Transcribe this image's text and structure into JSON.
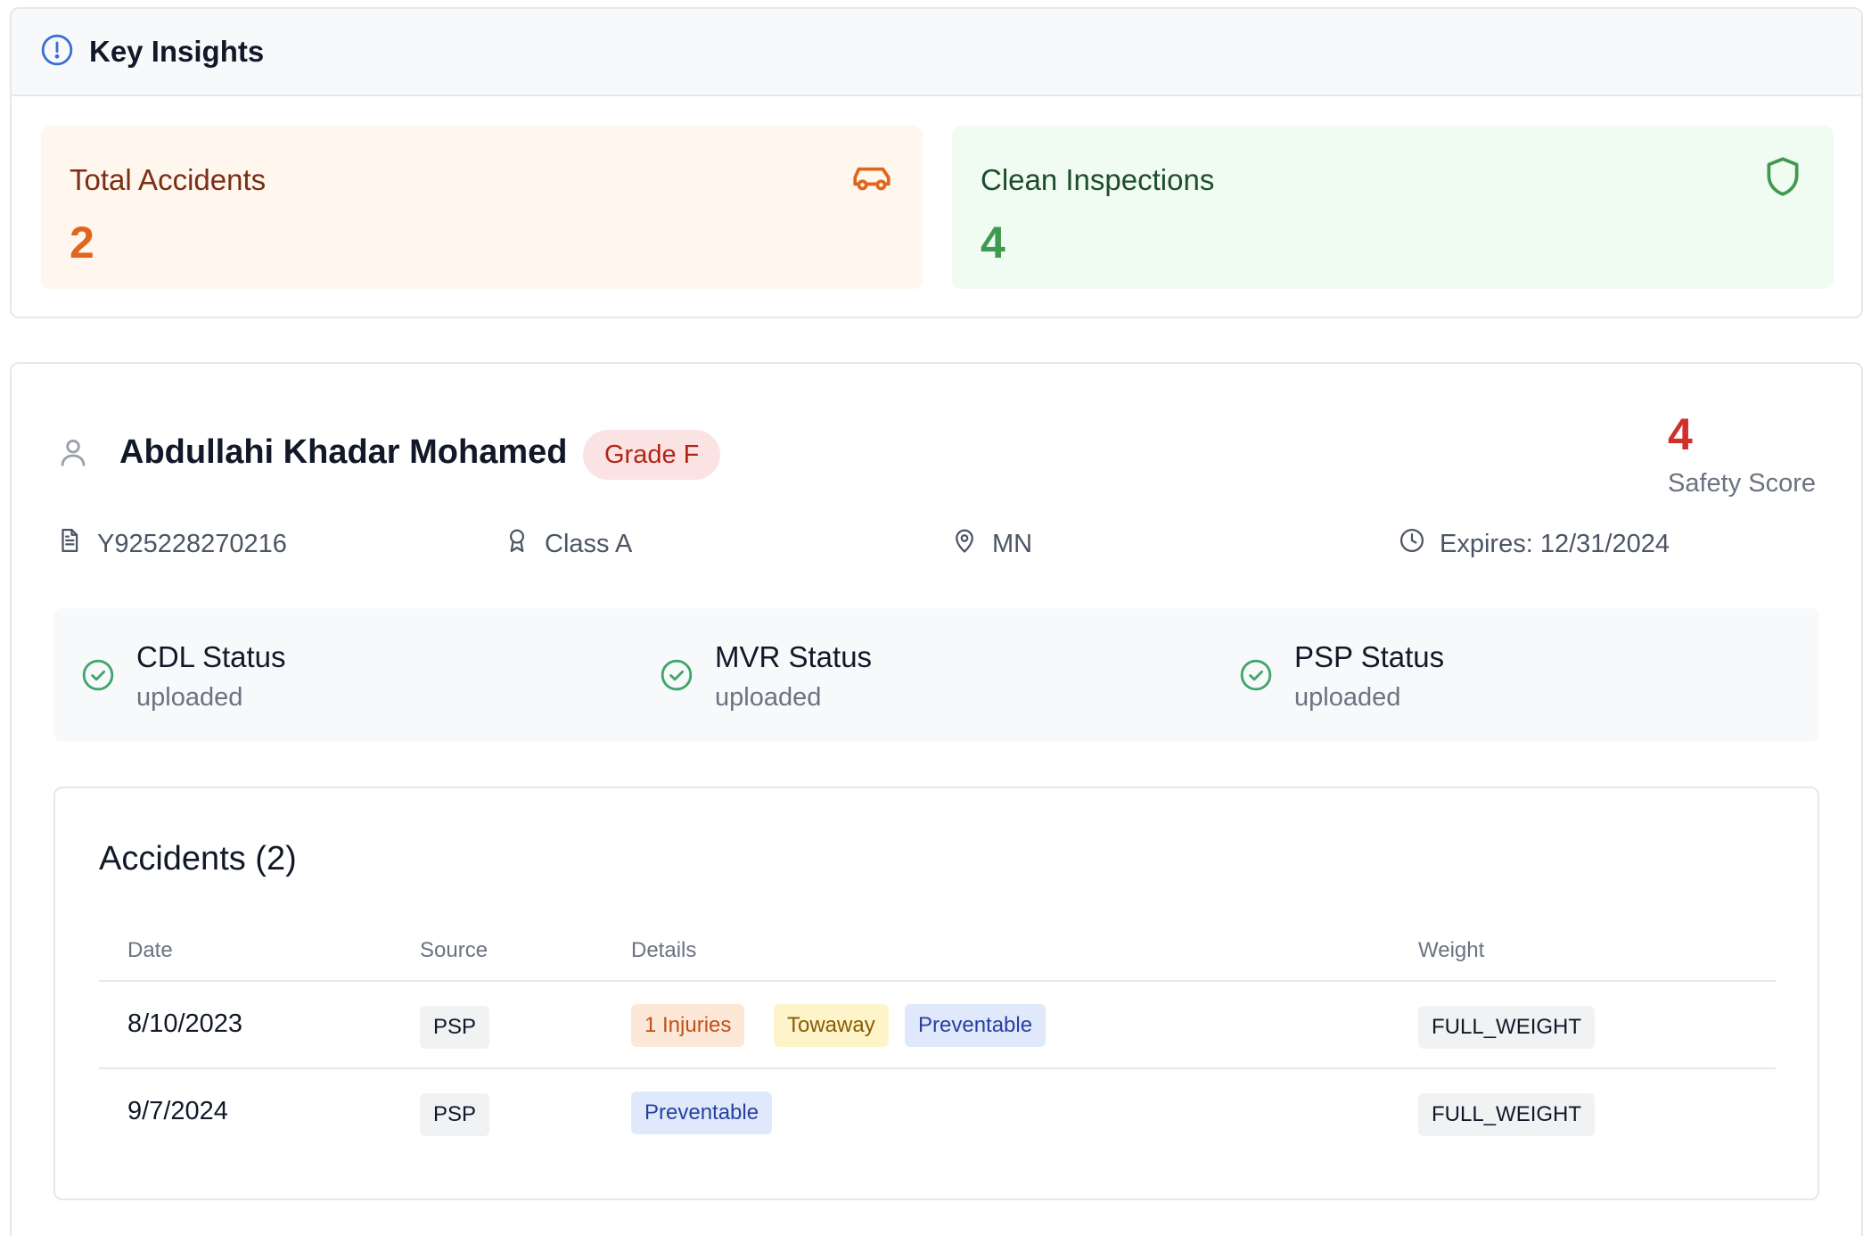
{
  "insights": {
    "title": "Key Insights",
    "total_accidents": {
      "label": "Total Accidents",
      "value": "2"
    },
    "clean_inspections": {
      "label": "Clean Inspections",
      "value": "4"
    }
  },
  "driver": {
    "name": "Abdullahi Khadar Mohamed",
    "grade": "Grade F",
    "safety_score": {
      "value": "4",
      "label": "Safety Score"
    },
    "license_number": "Y925228270216",
    "license_class": "Class A",
    "state": "MN",
    "expires": "Expires: 12/31/2024"
  },
  "statuses": [
    {
      "title": "CDL Status",
      "value": "uploaded"
    },
    {
      "title": "MVR Status",
      "value": "uploaded"
    },
    {
      "title": "PSP Status",
      "value": "uploaded"
    }
  ],
  "accidents": {
    "title": "Accidents (2)",
    "headers": {
      "date": "Date",
      "source": "Source",
      "details": "Details",
      "weight": "Weight"
    },
    "rows": [
      {
        "date": "8/10/2023",
        "source": "PSP",
        "tags": [
          "1 Injuries",
          "Towaway",
          "Preventable"
        ],
        "weight": "FULL_WEIGHT"
      },
      {
        "date": "9/7/2024",
        "source": "PSP",
        "tags": [
          "Preventable"
        ],
        "weight": "FULL_WEIGHT"
      }
    ]
  },
  "colors": {
    "accent_blue": "#3b6fd4",
    "accident_orange": "#e0661f",
    "inspection_green": "#3f9a4e",
    "danger_red": "#d22f2a",
    "status_green": "#3fa66a"
  }
}
